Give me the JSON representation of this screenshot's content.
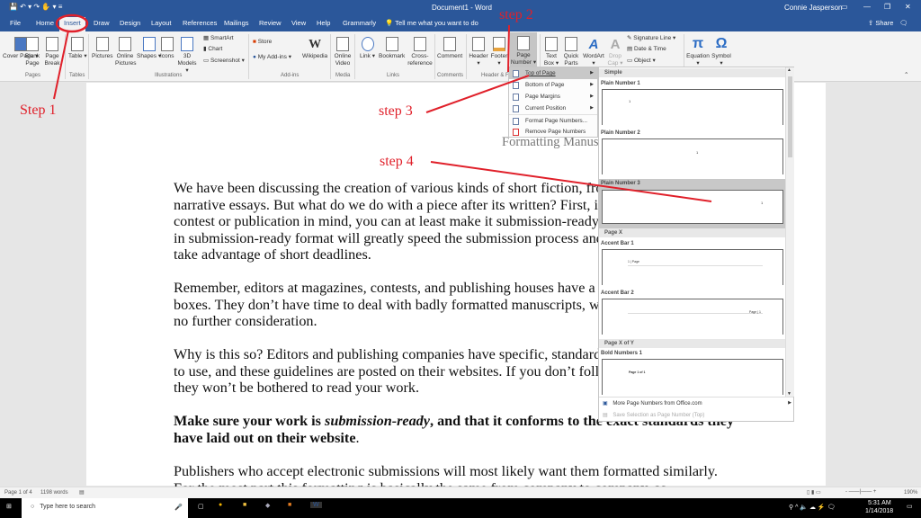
{
  "titlebar": {
    "doc_title": "Document1 - Word",
    "user": "Connie Jasperson",
    "share": "Share"
  },
  "tabs": [
    "File",
    "Home",
    "Insert",
    "Draw",
    "Design",
    "Layout",
    "References",
    "Mailings",
    "Review",
    "View",
    "Help",
    "Grammarly"
  ],
  "tell_me": "Tell me what you want to do",
  "ribbon": {
    "buttons": [
      {
        "label": "Cover Page ▾",
        "group": "Pages"
      },
      {
        "label": "Blank Page"
      },
      {
        "label": "Page Break"
      },
      {
        "label": "Table ▾"
      },
      {
        "label": "Pictures"
      },
      {
        "label": "Online Pictures"
      },
      {
        "label": "Shapes ▾"
      },
      {
        "label": "Icons"
      },
      {
        "label": "3D Models ▾"
      },
      {
        "label": "SmartArt"
      },
      {
        "label": "Chart"
      },
      {
        "label": "Screenshot ▾"
      },
      {
        "label": "Store"
      },
      {
        "label": "My Add-ins ▾"
      },
      {
        "label": "Wikipedia"
      },
      {
        "label": "Online Video"
      },
      {
        "label": "Link ▾"
      },
      {
        "label": "Bookmark"
      },
      {
        "label": "Cross-reference"
      },
      {
        "label": "Comment"
      },
      {
        "label": "Header ▾"
      },
      {
        "label": "Footer ▾"
      },
      {
        "label": "Page Number ▾"
      },
      {
        "label": "Text Box ▾"
      },
      {
        "label": "Quick Parts ▾"
      },
      {
        "label": "WordArt ▾"
      },
      {
        "label": "Drop Cap ▾"
      },
      {
        "label": "Signature Line ▾"
      },
      {
        "label": "Date & Time"
      },
      {
        "label": "Object ▾"
      },
      {
        "label": "Equation ▾"
      },
      {
        "label": "Symbol ▾"
      }
    ],
    "groups": [
      "Pages",
      "Tables",
      "Illustrations",
      "Add-ins",
      "Media",
      "Links",
      "Comments",
      "Header & F"
    ]
  },
  "menu": {
    "items": [
      "Top of Page",
      "Bottom of Page",
      "Page Margins",
      "Current Position",
      "Format Page Numbers...",
      "Remove Page Numbers"
    ]
  },
  "gallery": {
    "headers": [
      "Simple",
      "Page X",
      "Page X of Y"
    ],
    "items": [
      "Plain Number 1",
      "Plain Number 2",
      "Plain Number 3",
      "Accent Bar 1",
      "Accent Bar 2",
      "Bold Numbers 1"
    ],
    "previews": [
      "1",
      "1",
      "1",
      "1 | Page",
      "Page | 1",
      "Page 1 of 1"
    ],
    "footer": [
      "More Page Numbers from Office.com",
      "Save Selection as Page Number (Top)"
    ]
  },
  "document": {
    "heading": "Formatting Manuscripts",
    "p1": "We have been discussing the creation of various kinds of short fiction, from flash fiction to narrative essays. But what do we do with a piece after its written? First, if you have a specific contest or publication in mind, you can at least make it submission-ready. Having a manuscript in submission-ready format will greatly speed the submission process and will enable you to take advantage of short deadlines.",
    "p2": "Remember, editors at magazines, contests, and publishing houses have a lot of work in their in-boxes. They don’t have time to deal with badly formatted manuscripts, which are discarded with no further consideration.",
    "p3": "Why is this so? Editors and publishing companies have specific, standard formats they want you to use, and these guidelines are posted on their websites. If you don’t follow their guidelines, they won’t be bothered to read your work.",
    "p4a": "Make sure your work is ",
    "p4b": "submission-ready",
    "p4c": ", and that it conforms to the exact standards they have laid out on their website",
    "p4d": ".",
    "p5": "Publishers who accept electronic submissions will most likely want them formatted similarly. For the most part this formatting is basically the same from company to company, as"
  },
  "status": {
    "page": "Page 1 of 4",
    "words": "1198 words",
    "zoom": "190%"
  },
  "taskbar": {
    "search": "Type here to search",
    "time": "5:31 AM",
    "date": "1/14/2018"
  },
  "annotations": {
    "step1": "Step 1",
    "step2": "step 2",
    "step3": "step 3",
    "step4": "step 4",
    "color": "#e0202a"
  }
}
